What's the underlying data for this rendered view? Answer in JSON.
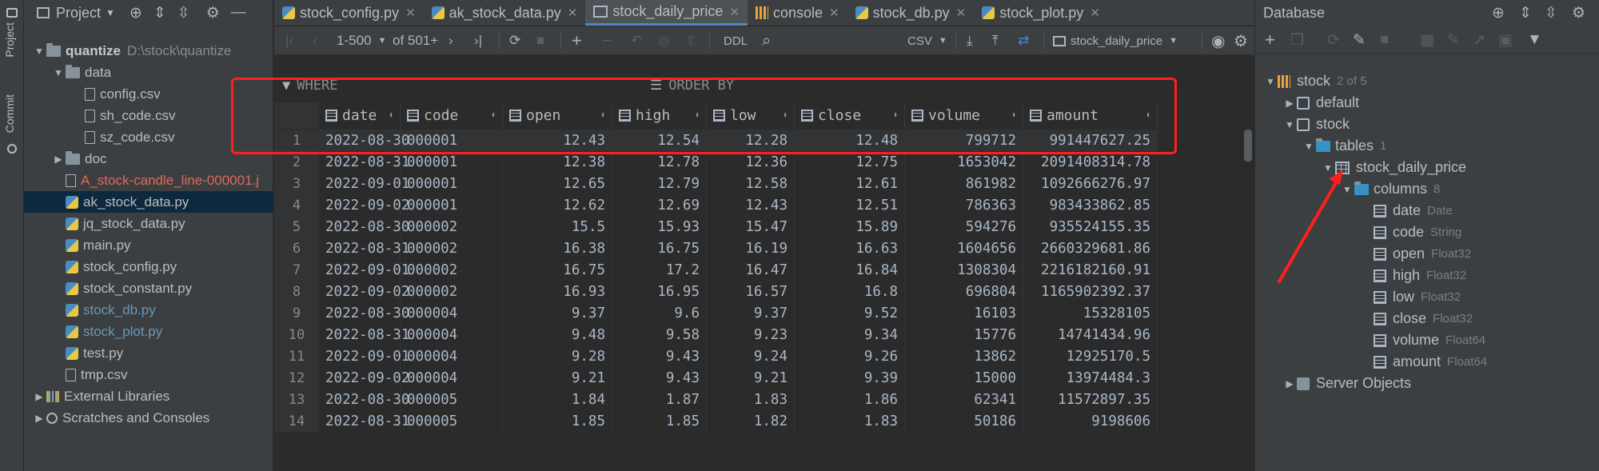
{
  "left_strip": {
    "project_label": "Project",
    "commit_label": "Commit"
  },
  "project": {
    "header_title": "Project",
    "tree": [
      {
        "label": "quantize",
        "path": "D:\\stock\\quantize",
        "kind": "root"
      },
      {
        "label": "data",
        "kind": "folder"
      },
      {
        "label": "config.csv",
        "kind": "file"
      },
      {
        "label": "sh_code.csv",
        "kind": "file"
      },
      {
        "label": "sz_code.csv",
        "kind": "file"
      },
      {
        "label": "doc",
        "kind": "folder"
      },
      {
        "label": "A_stock-candle_line-000001.j",
        "kind": "file-red"
      },
      {
        "label": "ak_stock_data.py",
        "kind": "py"
      },
      {
        "label": "jq_stock_data.py",
        "kind": "py"
      },
      {
        "label": "main.py",
        "kind": "py"
      },
      {
        "label": "stock_config.py",
        "kind": "py"
      },
      {
        "label": "stock_constant.py",
        "kind": "py"
      },
      {
        "label": "stock_db.py",
        "kind": "py-blue"
      },
      {
        "label": "stock_plot.py",
        "kind": "py-blue"
      },
      {
        "label": "test.py",
        "kind": "py"
      },
      {
        "label": "tmp.csv",
        "kind": "file"
      },
      {
        "label": "External Libraries",
        "kind": "lib"
      },
      {
        "label": "Scratches and Consoles",
        "kind": "scratch"
      }
    ]
  },
  "tabs": [
    {
      "label": "stock_config.py"
    },
    {
      "label": "ak_stock_data.py"
    },
    {
      "label": "stock_daily_price"
    },
    {
      "label": "console"
    },
    {
      "label": "stock_db.py"
    },
    {
      "label": "stock_plot.py"
    }
  ],
  "toolbar": {
    "page_range": "1-500",
    "page_total": "of 501+",
    "ddl": "DDL",
    "export_format": "CSV",
    "table_selector": "stock_daily_price"
  },
  "filters": {
    "where": "WHERE",
    "order_by": "ORDER BY"
  },
  "grid": {
    "columns": [
      "date",
      "code",
      "open",
      "high",
      "low",
      "close",
      "volume",
      "amount"
    ],
    "rows": [
      [
        "1",
        "2022-08-30",
        "000001",
        "12.43",
        "12.54",
        "12.28",
        "12.48",
        "799712",
        "991447627.25"
      ],
      [
        "2",
        "2022-08-31",
        "000001",
        "12.38",
        "12.78",
        "12.36",
        "12.75",
        "1653042",
        "2091408314.78"
      ],
      [
        "3",
        "2022-09-01",
        "000001",
        "12.65",
        "12.79",
        "12.58",
        "12.61",
        "861982",
        "1092666276.97"
      ],
      [
        "4",
        "2022-09-02",
        "000001",
        "12.62",
        "12.69",
        "12.43",
        "12.51",
        "786363",
        "983433862.85"
      ],
      [
        "5",
        "2022-08-30",
        "000002",
        "15.5",
        "15.93",
        "15.47",
        "15.89",
        "594276",
        "935524155.35"
      ],
      [
        "6",
        "2022-08-31",
        "000002",
        "16.38",
        "16.75",
        "16.19",
        "16.63",
        "1604656",
        "2660329681.86"
      ],
      [
        "7",
        "2022-09-01",
        "000002",
        "16.75",
        "17.2",
        "16.47",
        "16.84",
        "1308304",
        "2216182160.91"
      ],
      [
        "8",
        "2022-09-02",
        "000002",
        "16.93",
        "16.95",
        "16.57",
        "16.8",
        "696804",
        "1165902392.37"
      ],
      [
        "9",
        "2022-08-30",
        "000004",
        "9.37",
        "9.6",
        "9.37",
        "9.52",
        "16103",
        "15328105"
      ],
      [
        "10",
        "2022-08-31",
        "000004",
        "9.48",
        "9.58",
        "9.23",
        "9.34",
        "15776",
        "14741434.96"
      ],
      [
        "11",
        "2022-09-01",
        "000004",
        "9.28",
        "9.43",
        "9.24",
        "9.26",
        "13862",
        "12925170.5"
      ],
      [
        "12",
        "2022-09-02",
        "000004",
        "9.21",
        "9.43",
        "9.21",
        "9.39",
        "15000",
        "13974484.3"
      ],
      [
        "13",
        "2022-08-30",
        "000005",
        "1.84",
        "1.87",
        "1.83",
        "1.86",
        "62341",
        "11572897.35"
      ],
      [
        "14",
        "2022-08-31",
        "000005",
        "1.85",
        "1.85",
        "1.82",
        "1.83",
        "50186",
        "9198606"
      ]
    ]
  },
  "database": {
    "header_title": "Database",
    "tree": [
      {
        "label": "stock",
        "meta": "2 of 5",
        "kind": "db"
      },
      {
        "label": "default",
        "meta": "",
        "kind": "schema"
      },
      {
        "label": "stock",
        "meta": "",
        "kind": "schema"
      },
      {
        "label": "tables",
        "meta": "1",
        "kind": "folder"
      },
      {
        "label": "stock_daily_price",
        "meta": "",
        "kind": "table"
      },
      {
        "label": "columns",
        "meta": "8",
        "kind": "folder"
      },
      {
        "label": "date",
        "meta": "Date",
        "kind": "column"
      },
      {
        "label": "code",
        "meta": "String",
        "kind": "column"
      },
      {
        "label": "open",
        "meta": "Float32",
        "kind": "column"
      },
      {
        "label": "high",
        "meta": "Float32",
        "kind": "column"
      },
      {
        "label": "low",
        "meta": "Float32",
        "kind": "column"
      },
      {
        "label": "close",
        "meta": "Float32",
        "kind": "column"
      },
      {
        "label": "volume",
        "meta": "Float64",
        "kind": "column"
      },
      {
        "label": "amount",
        "meta": "Float64",
        "kind": "column"
      },
      {
        "label": "Server Objects",
        "meta": "",
        "kind": "server"
      }
    ]
  },
  "colors": {
    "highlight": "#ff1f1f",
    "selection": "#0d293e",
    "accent": "#4a88c7"
  }
}
